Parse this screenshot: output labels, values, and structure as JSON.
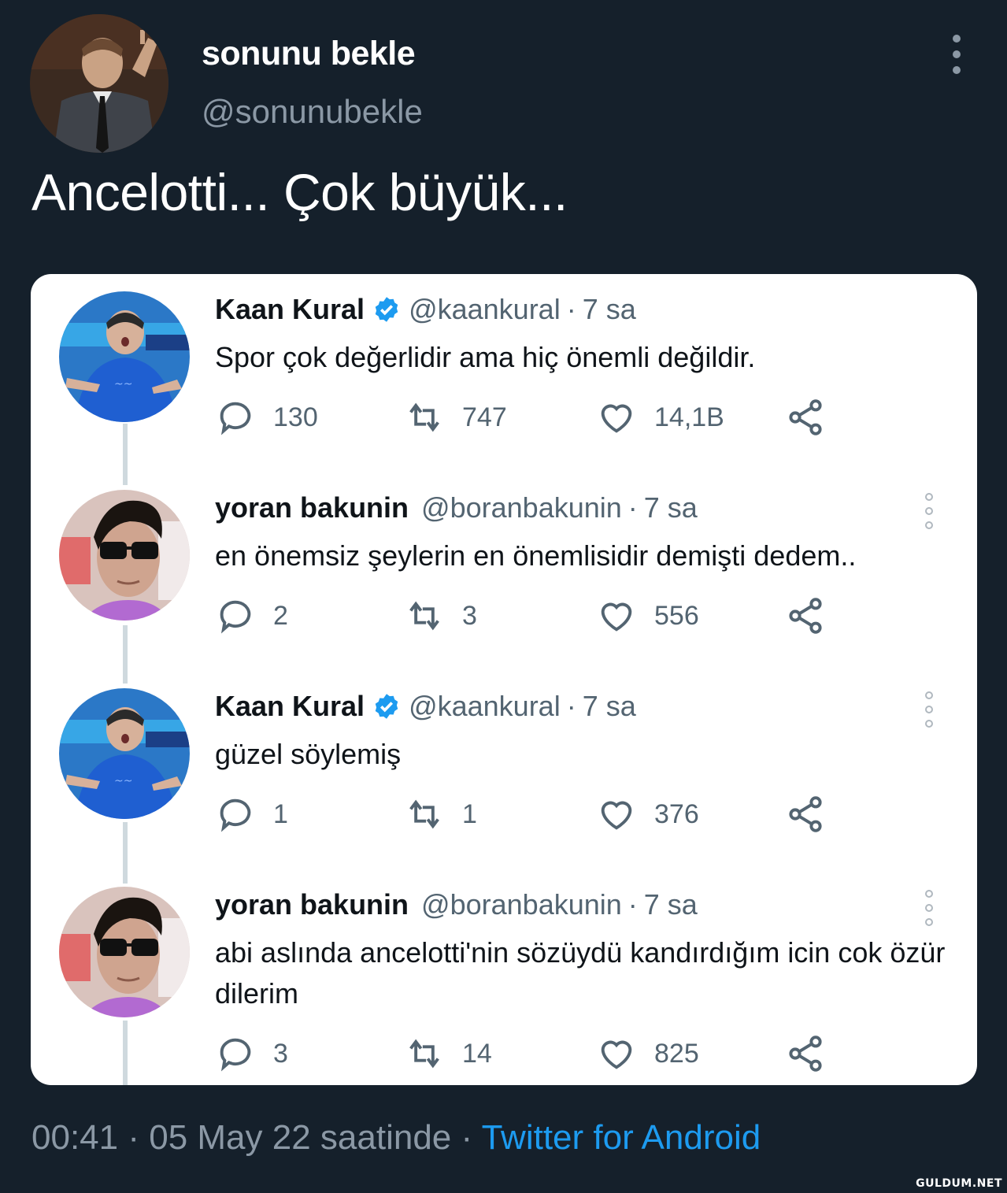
{
  "author": {
    "display_name": "sonunu bekle",
    "handle": "@sonunubekle"
  },
  "tweet_text": "Ancelotti... Çok büyük...",
  "embedded_thread": [
    {
      "name": "Kaan Kural",
      "verified": true,
      "handle": "@kaankural",
      "separator": "·",
      "time": "7 sa",
      "text": "Spor çok değerlidir ama hiç önemli değildir.",
      "replies": "130",
      "retweets": "747",
      "likes": "14,1B",
      "show_more": false
    },
    {
      "name": "yoran bakunin",
      "verified": false,
      "handle": "@boranbakunin",
      "separator": "·",
      "time": "7 sa",
      "text": "en önemsiz şeylerin en önemlisidir demişti dedem..",
      "replies": "2",
      "retweets": "3",
      "likes": "556",
      "show_more": true
    },
    {
      "name": "Kaan Kural",
      "verified": true,
      "handle": "@kaankural",
      "separator": "·",
      "time": "7 sa",
      "text": "güzel söylemiş",
      "replies": "1",
      "retweets": "1",
      "likes": "376",
      "show_more": true
    },
    {
      "name": "yoran bakunin",
      "verified": false,
      "handle": "@boranbakunin",
      "separator": "·",
      "time": "7 sa",
      "text": "abi aslında ancelotti'nin sözüydü kandırdığım icin cok özür dilerim",
      "replies": "3",
      "retweets": "14",
      "likes": "825",
      "show_more": true
    }
  ],
  "footer": {
    "time": "00:41",
    "separator1": "·",
    "date": "05 May 22 saatinde",
    "separator2": "·",
    "source": "Twitter for Android"
  },
  "watermark": "GULDUM.NET",
  "colors": {
    "background": "#15202b",
    "accent": "#1d9bf0",
    "muted": "#8b98a5",
    "verified": "#1d9bf0"
  }
}
